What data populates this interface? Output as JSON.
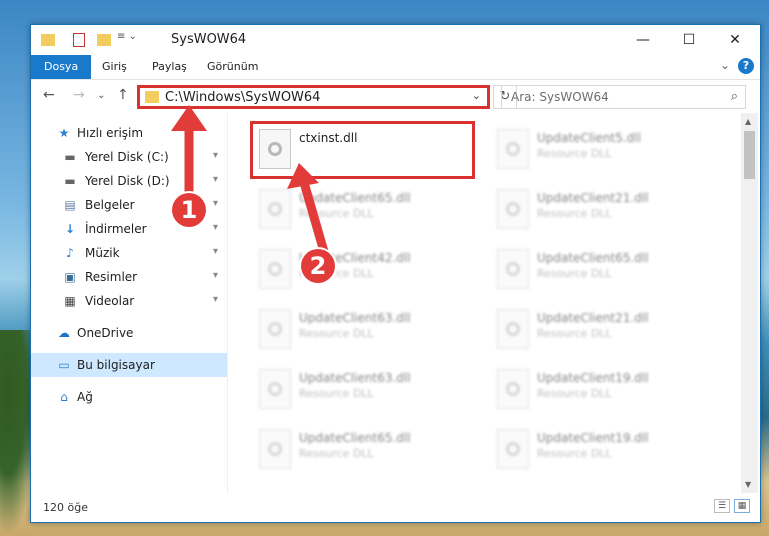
{
  "window": {
    "title": "SysWOW64"
  },
  "titlebar": {
    "minimize": "—",
    "maximize": "☐",
    "close": "✕"
  },
  "ribbon": {
    "tabs": [
      "Dosya",
      "Giriş",
      "Paylaş",
      "Görünüm"
    ],
    "expand": "⌄",
    "help": "?"
  },
  "nav": {
    "back": "←",
    "forward": "→",
    "recent": "⌄",
    "up": "↑",
    "address_path": "C:\\Windows\\SysWOW64",
    "address_dropdown": "⌄",
    "refresh": "↻",
    "search_placeholder": "Ara: SysWOW64",
    "search_icon": "⌕"
  },
  "sidebar": {
    "items": [
      {
        "label": "Hızlı erişim",
        "icon": "star-icon",
        "glyph": "★",
        "pinned": false
      },
      {
        "label": "Yerel Disk (C:)",
        "icon": "drive-icon",
        "glyph": "▬",
        "pinned": true
      },
      {
        "label": "Yerel Disk (D:)",
        "icon": "drive-icon",
        "glyph": "▬",
        "pinned": true
      },
      {
        "label": "Belgeler",
        "icon": "documents-icon",
        "glyph": "▤",
        "pinned": true
      },
      {
        "label": "İndirmeler",
        "icon": "download-icon",
        "glyph": "↓",
        "pinned": true
      },
      {
        "label": "Müzik",
        "icon": "music-icon",
        "glyph": "♪",
        "pinned": true
      },
      {
        "label": "Resimler",
        "icon": "pictures-icon",
        "glyph": "▣",
        "pinned": true
      },
      {
        "label": "Videolar",
        "icon": "videos-icon",
        "glyph": "▦",
        "pinned": true
      },
      {
        "label": "OneDrive",
        "icon": "cloud-icon",
        "glyph": "☁",
        "pinned": false
      },
      {
        "label": "Bu bilgisayar",
        "icon": "computer-icon",
        "glyph": "▭",
        "pinned": false
      },
      {
        "label": "Ağ",
        "icon": "network-icon",
        "glyph": "⌂",
        "pinned": false
      }
    ],
    "pin_glyph": "📌"
  },
  "files": [
    {
      "name": "ctxinst.dll",
      "type": ""
    },
    {
      "name": "UpdateClient5.dll",
      "type": "Resource DLL"
    },
    {
      "name": "UpdateClient65.dll",
      "type": "Resource DLL"
    },
    {
      "name": "UpdateClient21.dll",
      "type": "Resource DLL"
    },
    {
      "name": "UpdateClient42.dll",
      "type": "Resource DLL"
    },
    {
      "name": "UpdateClient65.dll",
      "type": "Resource DLL"
    },
    {
      "name": "UpdateClient63.dll",
      "type": "Resource DLL"
    },
    {
      "name": "UpdateClient21.dll",
      "type": "Resource DLL"
    },
    {
      "name": "UpdateClient63.dll",
      "type": "Resource DLL"
    },
    {
      "name": "UpdateClient19.dll",
      "type": "Resource DLL"
    },
    {
      "name": "UpdateClient65.dll",
      "type": "Resource DLL"
    },
    {
      "name": "UpdateClient19.dll",
      "type": "Resource DLL"
    }
  ],
  "status": {
    "count": "120 öğe",
    "details_view": "☰",
    "tiles_view": "▦"
  },
  "markers": [
    "1",
    "2"
  ],
  "colors": {
    "accent": "#1979ca",
    "highlight": "#d9312f",
    "marker": "#e23c3a",
    "selected": "#cde8ff"
  }
}
